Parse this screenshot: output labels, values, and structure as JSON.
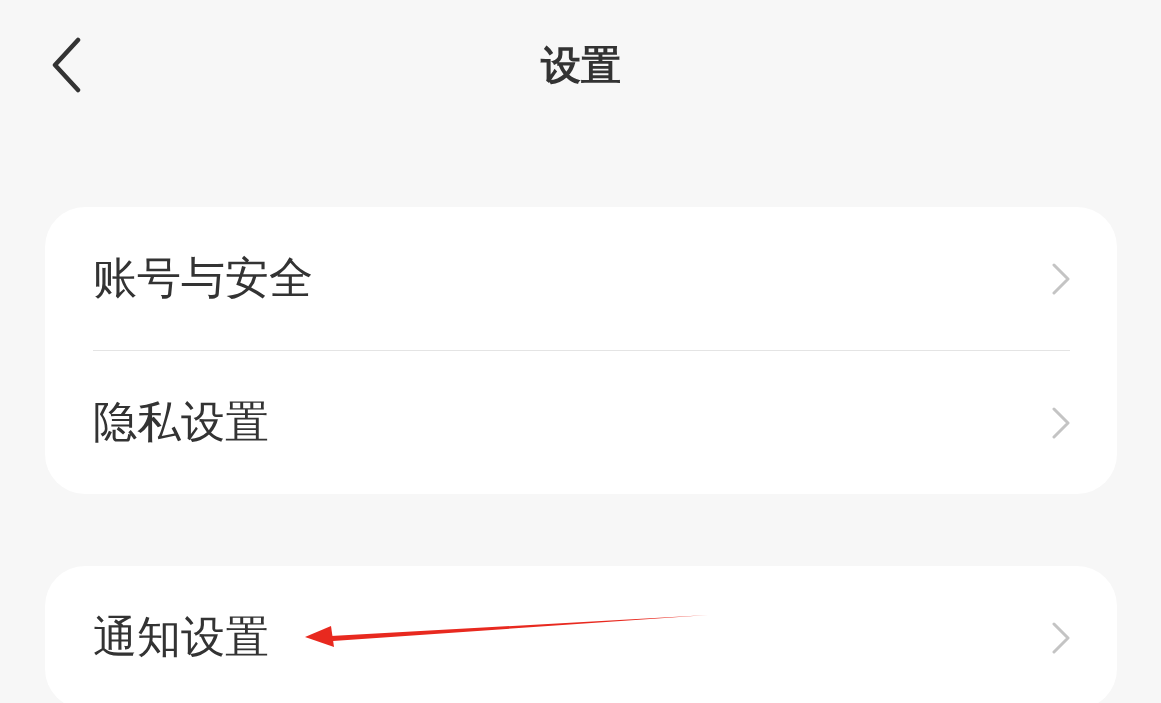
{
  "header": {
    "title": "设置"
  },
  "groups": [
    {
      "items": [
        {
          "label": "账号与安全"
        },
        {
          "label": "隐私设置"
        }
      ]
    },
    {
      "items": [
        {
          "label": "通知设置"
        }
      ]
    }
  ]
}
